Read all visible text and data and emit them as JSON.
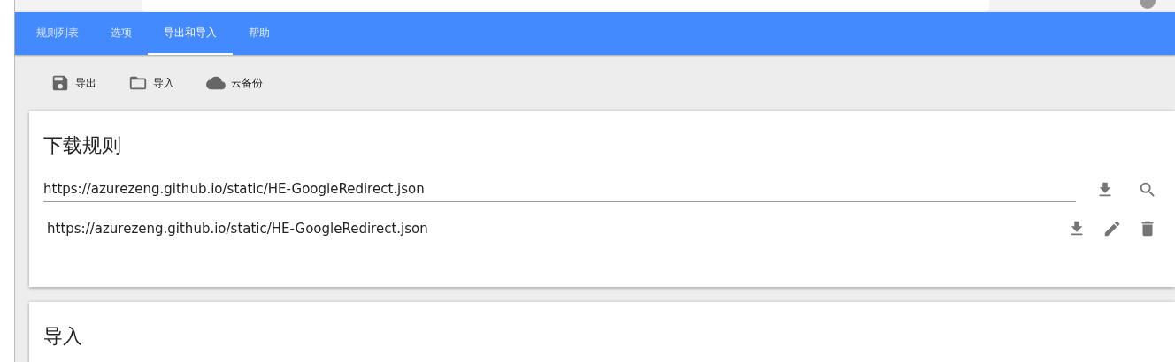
{
  "tabs": [
    {
      "label": "规则列表",
      "selected": false
    },
    {
      "label": "选项",
      "selected": false
    },
    {
      "label": "导出和导入",
      "selected": true
    },
    {
      "label": "帮助",
      "selected": false
    }
  ],
  "toolbar": [
    {
      "label": "导出",
      "kind": "save"
    },
    {
      "label": "导入",
      "kind": "folder"
    },
    {
      "label": "云备份",
      "kind": "cloud"
    }
  ],
  "download_card": {
    "title": "下载规则",
    "url_field": {
      "value": "https://azurezeng.github.io/static/HE-GoogleRedirect.json"
    },
    "rules": [
      {
        "url": "https://azurezeng.github.io/static/HE-GoogleRedirect.json"
      }
    ]
  },
  "import_card": {
    "title": "导入"
  }
}
